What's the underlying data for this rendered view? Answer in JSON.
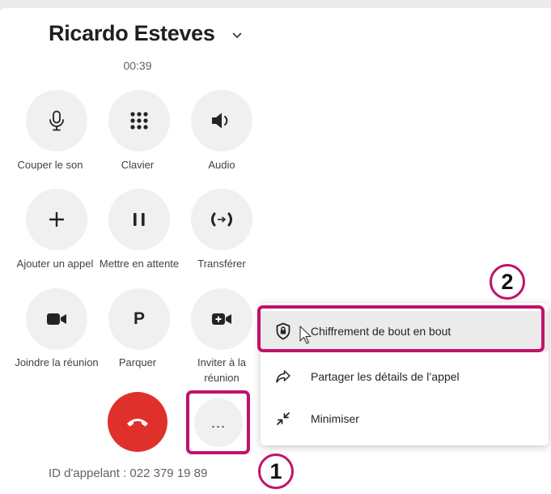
{
  "call": {
    "caller_name": "Ricardo Esteves",
    "timer": "00:39",
    "caller_id": "ID d'appelant : 022 379 19 89"
  },
  "controls": [
    {
      "label": "Couper le son",
      "icon": "microphone-icon"
    },
    {
      "label": "Clavier",
      "icon": "dialpad-icon"
    },
    {
      "label": "Audio",
      "icon": "speaker-icon"
    },
    {
      "label": "Ajouter un appel",
      "icon": "plus-icon"
    },
    {
      "label": "Mettre en attente",
      "icon": "pause-icon"
    },
    {
      "label": "Transférer",
      "icon": "transfer-icon"
    },
    {
      "label": "Joindre la réunion",
      "icon": "video-icon"
    },
    {
      "label": "Parquer",
      "icon": "park-icon",
      "glyph": "P"
    },
    {
      "label": "Inviter à la réunion",
      "icon": "video-add-icon"
    }
  ],
  "more_button": {
    "glyph": "..."
  },
  "hangup": {
    "icon": "phone-hangup-icon",
    "color": "#e0302b"
  },
  "menu": {
    "items": [
      {
        "label": "Chiffrement de bout en bout",
        "icon": "shield-lock-icon",
        "highlighted": true
      },
      {
        "label": "Partager les détails de l’appel",
        "icon": "share-arrow-icon"
      },
      {
        "label": "Minimiser",
        "icon": "minimize-icon"
      }
    ]
  },
  "annotations": [
    {
      "number": "1"
    },
    {
      "number": "2"
    }
  ],
  "colors": {
    "accent_highlight": "#c0136c",
    "hangup": "#e0302b",
    "button_bg": "#f0f0f0",
    "menu_hover": "#ebebeb"
  }
}
